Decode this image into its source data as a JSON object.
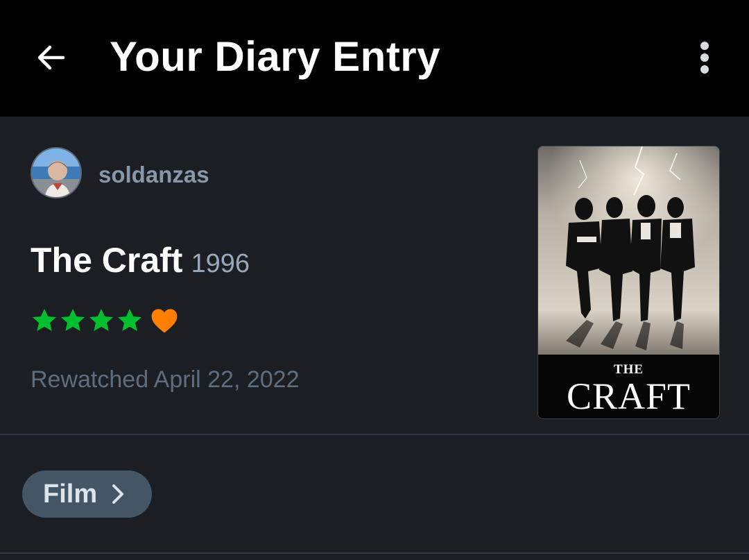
{
  "appbar": {
    "title": "Your Diary Entry",
    "back_icon": "arrow-left-icon",
    "menu_icon": "more-vertical-icon"
  },
  "entry": {
    "username": "soldanzas",
    "film_title": "The Craft",
    "film_year": "1996",
    "rating_stars": 4,
    "liked": true,
    "watched_text": "Rewatched April 22, 2022",
    "poster": {
      "title_small": "THE",
      "title_large": "CRAFT"
    }
  },
  "chip": {
    "label": "Film",
    "icon": "chevron-right-icon"
  },
  "colors": {
    "appbar_bg": "#000000",
    "page_bg": "#1b1e23",
    "star": "#00c030",
    "heart": "#ff8000",
    "chip_bg": "#445566"
  }
}
